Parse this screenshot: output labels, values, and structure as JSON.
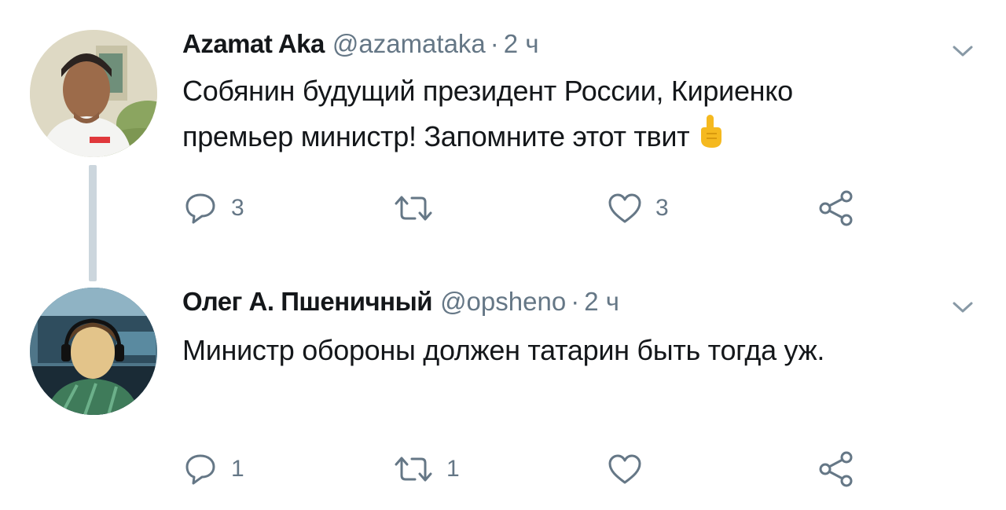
{
  "tweets": [
    {
      "display_name": "Azamat Aka",
      "handle": "@azamataka",
      "separator": "·",
      "time": "2 ч",
      "text_lines": [
        "Собянин будущий президент России, Кириенко",
        "премьер министр! Запомните этот твит"
      ],
      "emoji": "point-up",
      "reply_count": "3",
      "retweet_count": "",
      "like_count": "3"
    },
    {
      "display_name": "Олег А. Пшеничный",
      "handle": "@opsheno",
      "separator": "·",
      "time": "2 ч",
      "text_lines": [
        "Министр обороны должен татарин быть тогда уж."
      ],
      "reply_count": "1",
      "retweet_count": "1",
      "like_count": ""
    }
  ],
  "icons": {
    "reply": "reply-icon",
    "retweet": "retweet-icon",
    "like": "heart-icon",
    "share": "share-icon",
    "caret": "chevron-down-icon"
  },
  "colors": {
    "text": "#14171a",
    "secondary": "#657786",
    "thread_line": "#ccd6dd",
    "emoji": "#f5b91f"
  }
}
